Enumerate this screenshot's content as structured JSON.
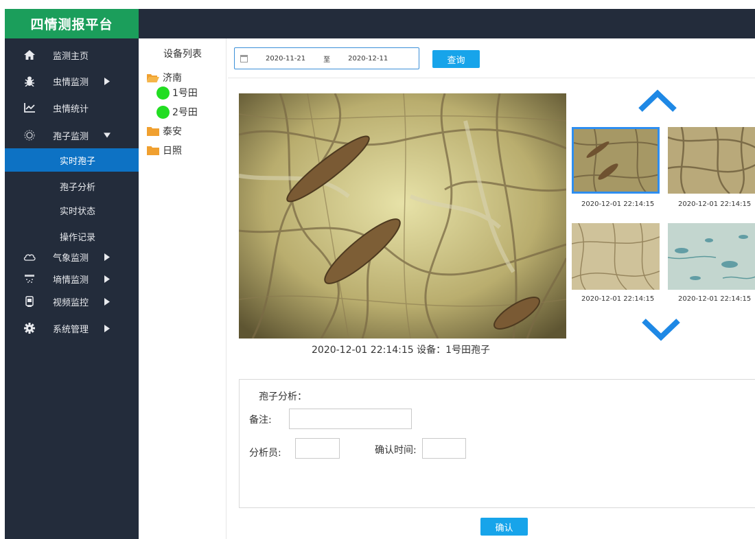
{
  "app": {
    "title": "四情测报平台"
  },
  "sidebar": {
    "items": [
      {
        "label": "监测主页",
        "icon": "home-icon"
      },
      {
        "label": "虫情监测",
        "icon": "bug-icon"
      },
      {
        "label": "虫情统计",
        "icon": "line-chart-icon"
      },
      {
        "label": "孢子监测",
        "icon": "spore-icon"
      },
      {
        "label": "气象监测",
        "icon": "cloud-icon"
      },
      {
        "label": "墒情监测",
        "icon": "soil-icon"
      },
      {
        "label": "视频监控",
        "icon": "video-icon"
      },
      {
        "label": "系统管理",
        "icon": "gear-icon"
      }
    ],
    "sub_items": [
      {
        "label": "实时孢子",
        "active": true
      },
      {
        "label": "孢子分析",
        "active": false
      },
      {
        "label": "实时状态",
        "active": false
      },
      {
        "label": "操作记录",
        "active": false
      }
    ]
  },
  "tree": {
    "title": "设备列表",
    "nodes": [
      {
        "label": "济南",
        "type": "folder-open"
      },
      {
        "label": "1号田",
        "type": "device-online"
      },
      {
        "label": "2号田",
        "type": "device-online"
      },
      {
        "label": "泰安",
        "type": "folder"
      },
      {
        "label": "日照",
        "type": "folder"
      }
    ]
  },
  "search": {
    "start_date": "2020-11-21",
    "separator": "至",
    "end_date": "2020-12-11",
    "query_label": "查询"
  },
  "viewer": {
    "caption": "2020-12-01 22:14:15 设备：1号田孢子",
    "thumbnails": [
      {
        "caption": "2020-12-01 22:14:15",
        "selected": true
      },
      {
        "caption": "2020-12-01 22:14:15",
        "selected": false
      },
      {
        "caption": "2020-12-01 22:14:15",
        "selected": false
      },
      {
        "caption": "2020-12-01 22:14:15",
        "selected": false
      }
    ]
  },
  "analysis": {
    "title": "孢子分析：",
    "remark_label": "备注:",
    "remark_value": "",
    "analyst_label": "分析员:",
    "analyst_value": "",
    "confirm_time_label": "确认时间:",
    "confirm_time_value": "",
    "confirm_label": "确认"
  },
  "colors": {
    "sidebar_bg": "#232c3b",
    "brand_bg": "#1b9e5b",
    "active_bg": "#0d72c4",
    "button_bg": "#17a4ea",
    "online_dot": "#22dd22",
    "folder": "#f0a030",
    "arrow": "#1e88e5"
  }
}
